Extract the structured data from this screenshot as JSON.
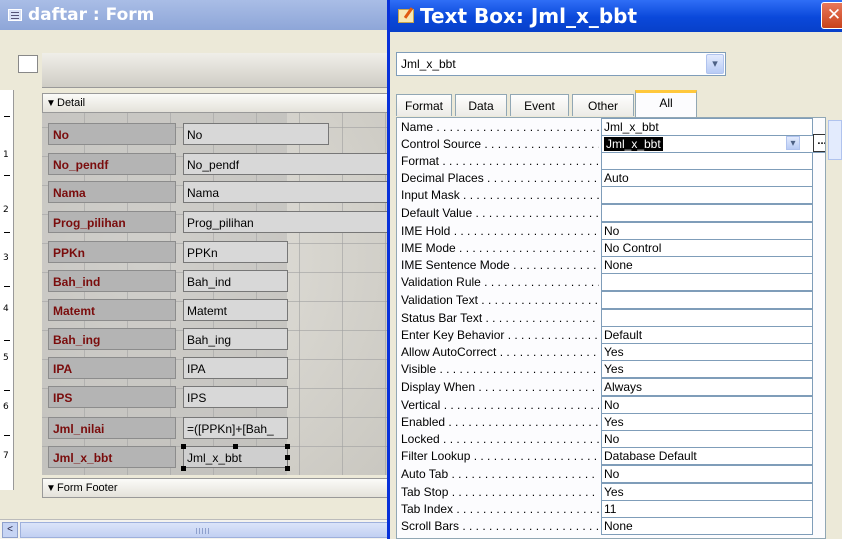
{
  "form_window": {
    "title": "daftar : Form",
    "ruler_numbers": [
      "1",
      "2",
      "3",
      "4",
      "5",
      "6"
    ],
    "vruler_numbers": [
      "1",
      "2",
      "3",
      "4",
      "5",
      "6",
      "7"
    ],
    "detail_section": "Detail",
    "footer_section": "Form Footer",
    "fields": [
      {
        "label": "No",
        "control": "No"
      },
      {
        "label": "No_pendf",
        "control": "No_pendf"
      },
      {
        "label": "Nama",
        "control": "Nama"
      },
      {
        "label": "Prog_pilihan",
        "control": "Prog_pilihan"
      },
      {
        "label": "PPKn",
        "control": "PPKn"
      },
      {
        "label": "Bah_ind",
        "control": "Bah_ind"
      },
      {
        "label": "Matemt",
        "control": "Matemt"
      },
      {
        "label": "Bah_ing",
        "control": "Bah_ing"
      },
      {
        "label": "IPA",
        "control": "IPA"
      },
      {
        "label": "IPS",
        "control": "IPS"
      },
      {
        "label": "Jml_nilai",
        "control": "=([PPKn]+[Bah_"
      },
      {
        "label": "Jml_x_bbt",
        "control": "Jml_x_bbt"
      }
    ]
  },
  "property_sheet": {
    "title": "Text Box: Jml_x_bbt",
    "object_select": "Jml_x_bbt",
    "tabs": [
      "Format",
      "Data",
      "Event",
      "Other",
      "All"
    ],
    "active_tab": "All",
    "properties": [
      {
        "name": "Name",
        "value": "Jml_x_bbt"
      },
      {
        "name": "Control Source",
        "value": "Jml_x_bbt"
      },
      {
        "name": "Format",
        "value": ""
      },
      {
        "name": "Decimal Places",
        "value": "Auto"
      },
      {
        "name": "Input Mask",
        "value": ""
      },
      {
        "name": "Default Value",
        "value": ""
      },
      {
        "name": "IME Hold",
        "value": "No"
      },
      {
        "name": "IME Mode",
        "value": "No Control"
      },
      {
        "name": "IME Sentence Mode",
        "value": "None"
      },
      {
        "name": "Validation Rule",
        "value": ""
      },
      {
        "name": "Validation Text",
        "value": ""
      },
      {
        "name": "Status Bar Text",
        "value": ""
      },
      {
        "name": "Enter Key Behavior",
        "value": "Default"
      },
      {
        "name": "Allow AutoCorrect",
        "value": "Yes"
      },
      {
        "name": "Visible",
        "value": "Yes"
      },
      {
        "name": "Display When",
        "value": "Always"
      },
      {
        "name": "Vertical",
        "value": "No"
      },
      {
        "name": "Enabled",
        "value": "Yes"
      },
      {
        "name": "Locked",
        "value": "No"
      },
      {
        "name": "Filter Lookup",
        "value": "Database Default"
      },
      {
        "name": "Auto Tab",
        "value": "No"
      },
      {
        "name": "Tab Stop",
        "value": "Yes"
      },
      {
        "name": "Tab Index",
        "value": "11"
      },
      {
        "name": "Scroll Bars",
        "value": "None"
      }
    ]
  },
  "icons": {
    "form_icon": "form-icon",
    "property_icon": "property-sheet-icon",
    "close": "✕",
    "dropdown": "▾",
    "builder": "...",
    "section_arrow": "▼",
    "scroll_left": "<"
  },
  "colors": {
    "xp_blue": "#0a46d8",
    "label_text": "#7a0c0c",
    "tab_highlight": "#ffc83c"
  }
}
